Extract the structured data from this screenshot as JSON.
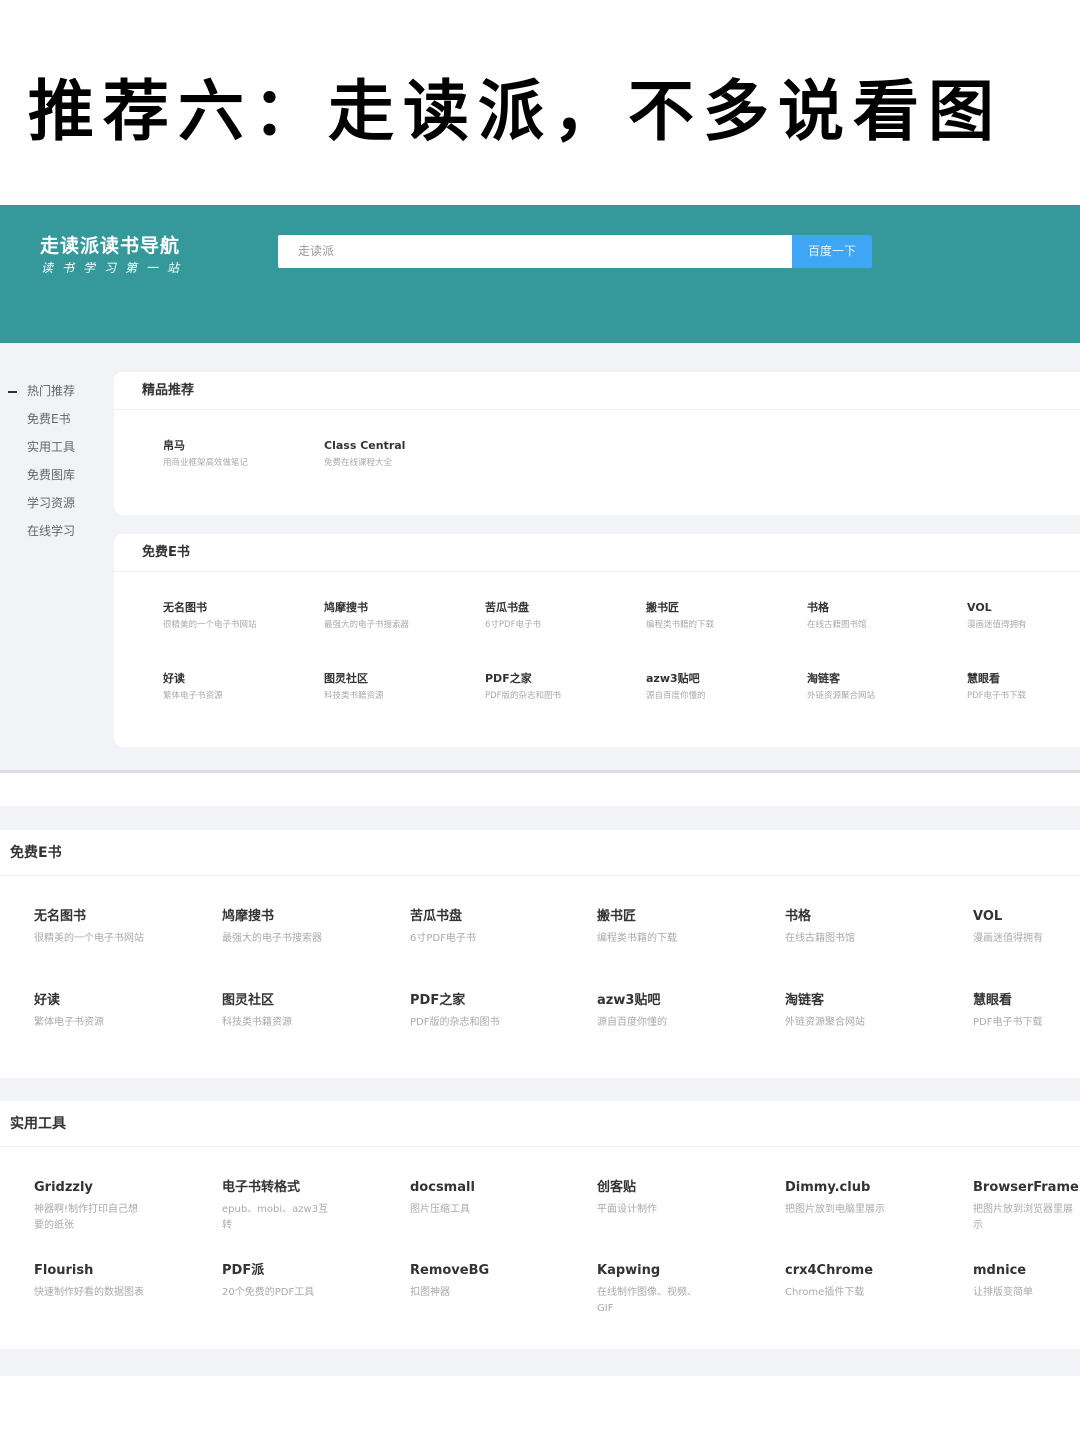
{
  "banner_title": "推荐六：走读派，不多说看图",
  "site": {
    "logo_title": "走读派读书导航",
    "logo_subtitle": "读书学习第一站",
    "search_placeholder": "走读派",
    "search_button": "百度一下"
  },
  "sidebar": {
    "items": [
      {
        "label": "热门推荐",
        "active": true
      },
      {
        "label": "免费E书",
        "active": false
      },
      {
        "label": "实用工具",
        "active": false
      },
      {
        "label": "免费图库",
        "active": false
      },
      {
        "label": "学习资源",
        "active": false
      },
      {
        "label": "在线学习",
        "active": false
      }
    ]
  },
  "featured": {
    "title": "精品推荐",
    "items": [
      {
        "name": "帛马",
        "desc": "用商业框架高效做笔记"
      },
      {
        "name": "Class Central",
        "desc": "免费在线课程大全"
      }
    ]
  },
  "ebooks": {
    "title": "免费E书",
    "items": [
      {
        "name": "无名图书",
        "desc": "很精美的一个电子书网站"
      },
      {
        "name": "鸠摩搜书",
        "desc": "最强大的电子书搜索器"
      },
      {
        "name": "苦瓜书盘",
        "desc": "6寸PDF电子书"
      },
      {
        "name": "搬书匠",
        "desc": "编程类书籍的下载"
      },
      {
        "name": "书格",
        "desc": "在线古籍图书馆"
      },
      {
        "name": "VOL",
        "desc": "漫画迷值得拥有"
      },
      {
        "name": "好读",
        "desc": "繁体电子书资源"
      },
      {
        "name": "图灵社区",
        "desc": "科技类书籍资源"
      },
      {
        "name": "PDF之家",
        "desc": "PDF版的杂志和图书"
      },
      {
        "name": "azw3贴吧",
        "desc": "源自百度你懂的"
      },
      {
        "name": "淘链客",
        "desc": "外链资源聚合网站"
      },
      {
        "name": "慧眼看",
        "desc": "PDF电子书下载"
      }
    ]
  },
  "tools": {
    "title": "实用工具",
    "items": [
      {
        "name": "Gridzzly",
        "desc": "神器啊!制作打印自己想要的纸张"
      },
      {
        "name": "电子书转格式",
        "desc": "epub、mobi、azw3互转"
      },
      {
        "name": "docsmall",
        "desc": "图片压缩工具"
      },
      {
        "name": "创客贴",
        "desc": "平面设计制作"
      },
      {
        "name": "Dimmy.club",
        "desc": "把图片放到电脑里展示"
      },
      {
        "name": "BrowserFrame",
        "desc": "把图片放到浏览器里展示"
      },
      {
        "name": "Flourish",
        "desc": "快速制作好看的数据图表"
      },
      {
        "name": "PDF派",
        "desc": "20个免费的PDF工具"
      },
      {
        "name": "RemoveBG",
        "desc": "扣图神器"
      },
      {
        "name": "Kapwing",
        "desc": "在线制作图像、视频、GIF"
      },
      {
        "name": "crx4Chrome",
        "desc": "Chrome插件下载"
      },
      {
        "name": "mdnice",
        "desc": "让排版变简单"
      }
    ]
  },
  "colors": {
    "header_bg": "#35999b",
    "search_button_bg": "#3ea6f5",
    "page_bg": "#f1f3f6"
  }
}
